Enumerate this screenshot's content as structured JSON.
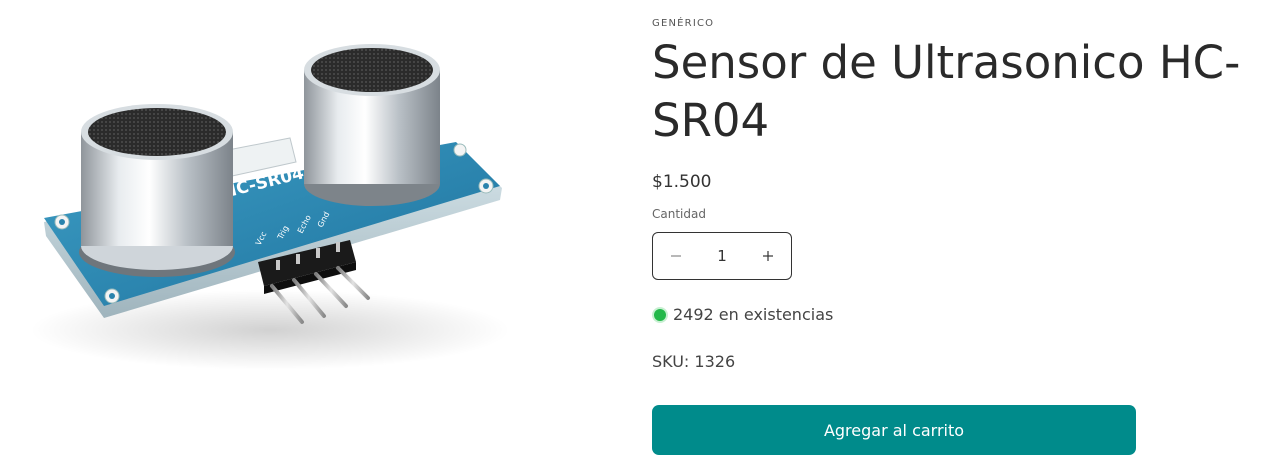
{
  "product": {
    "vendor": "GENÉRICO",
    "title": "Sensor de Ultrasonico HC-SR04",
    "price": "$1.500",
    "image_alt": "Sensor de Ultrasonico HC-SR04",
    "board_label": "HC-SR04",
    "pin_labels": [
      "Vcc",
      "Trig",
      "Echo",
      "Gnd"
    ]
  },
  "quantity": {
    "label": "Cantidad",
    "value": "1",
    "decrease_icon": "minus-icon",
    "increase_icon": "plus-icon"
  },
  "stock": {
    "text": "2492 en existencias",
    "status_color": "#23b84a"
  },
  "sku": {
    "text": "SKU: 1326"
  },
  "cart": {
    "button_label": "Agregar al carrito",
    "button_color": "#008b8b"
  }
}
